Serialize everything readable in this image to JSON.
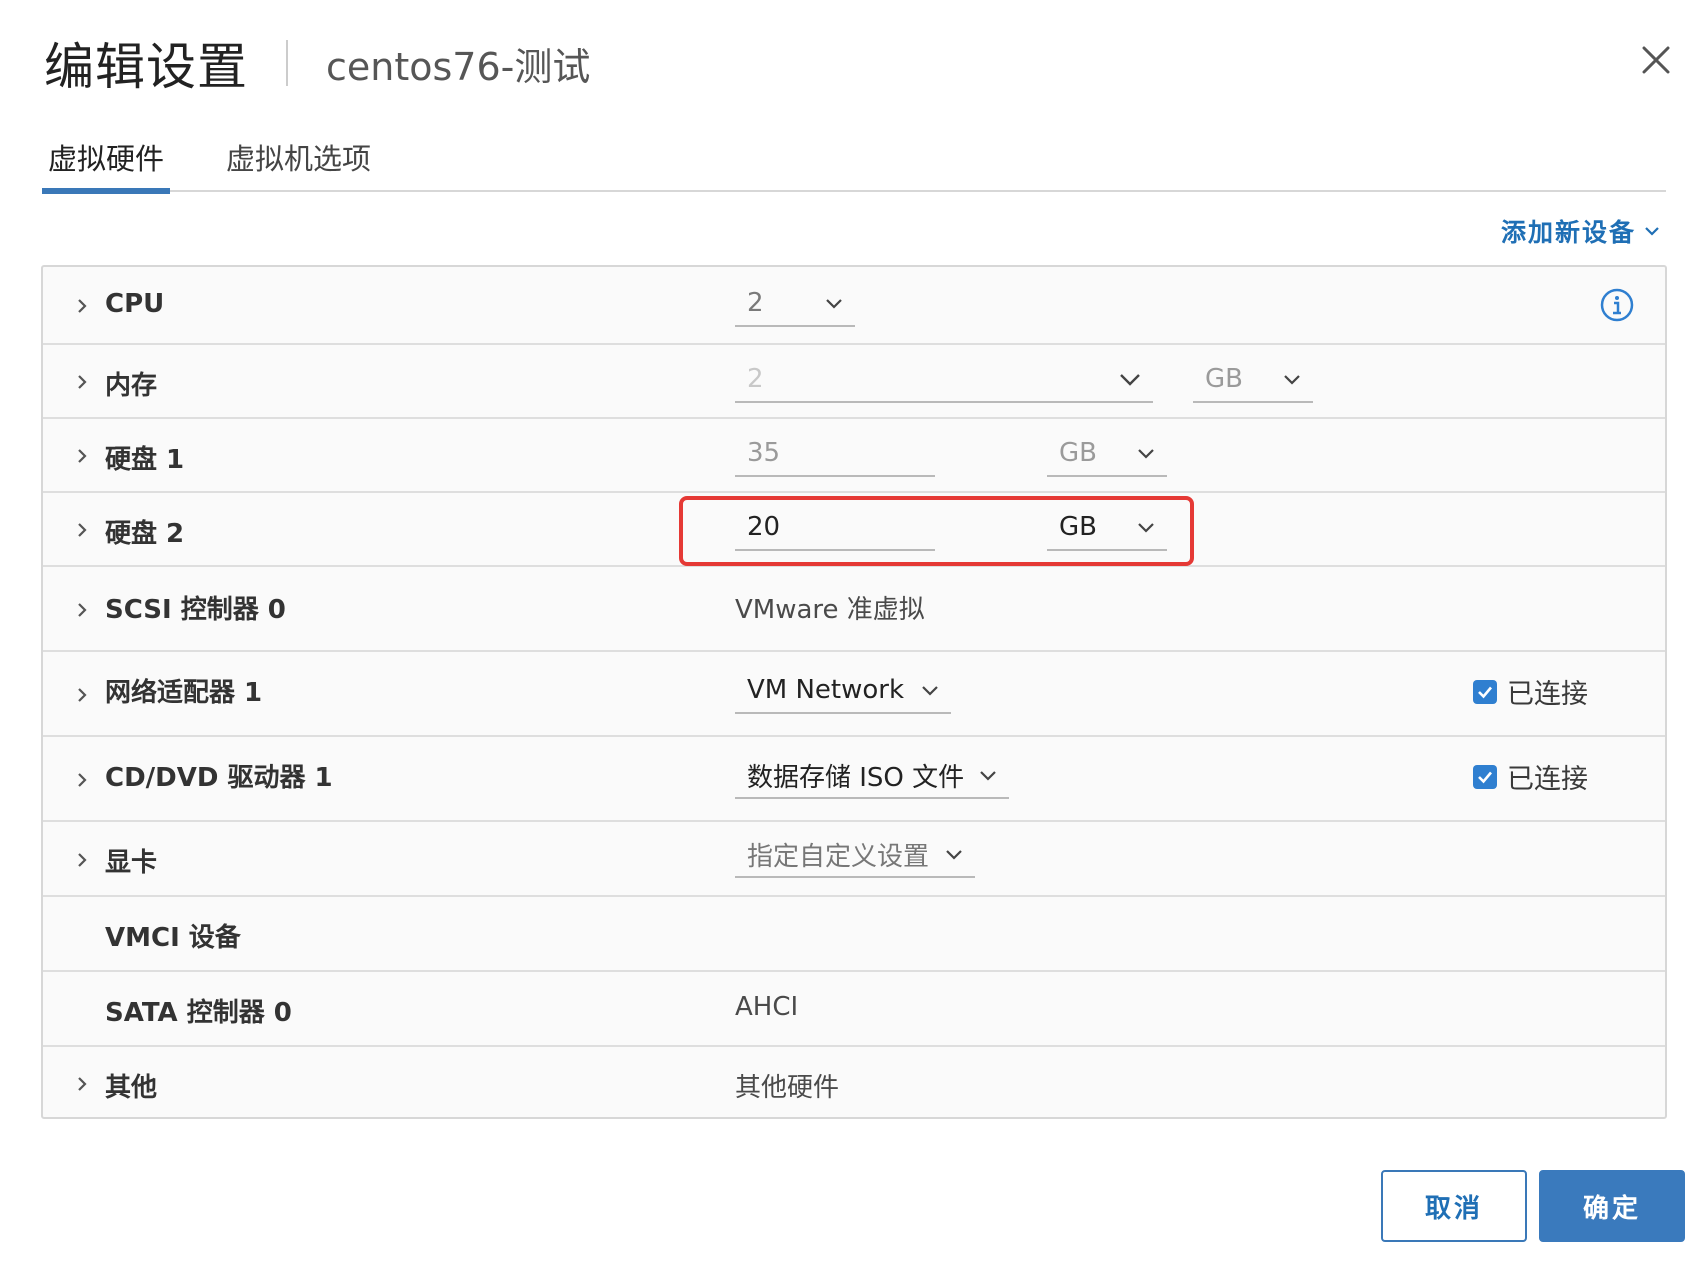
{
  "dialog": {
    "title": "编辑设置",
    "subtitle": "centos76-测试"
  },
  "tabs": [
    {
      "label": "虚拟硬件",
      "active": true
    },
    {
      "label": "虚拟机选项",
      "active": false
    }
  ],
  "add_device": "添加新设备",
  "rows": {
    "cpu": {
      "label": "CPU",
      "value": "2"
    },
    "memory": {
      "label": "内存",
      "value": "2",
      "unit": "GB"
    },
    "disk1": {
      "label": "硬盘 1",
      "value": "35",
      "unit": "GB"
    },
    "disk2": {
      "label": "硬盘 2",
      "value": "20",
      "unit": "GB"
    },
    "scsi": {
      "label": "SCSI 控制器 0",
      "value": "VMware 准虚拟"
    },
    "network": {
      "label": "网络适配器 1",
      "value": "VM Network",
      "connected_label": "已连接",
      "connected": true
    },
    "cddvd": {
      "label": "CD/DVD 驱动器 1",
      "value": "数据存储 ISO 文件",
      "connected_label": "已连接",
      "connected": true
    },
    "video": {
      "label": "显卡",
      "value": "指定自定义设置"
    },
    "vmci": {
      "label": "VMCI 设备"
    },
    "sata": {
      "label": "SATA 控制器 0",
      "value": "AHCI"
    },
    "other": {
      "label": "其他",
      "value": "其他硬件"
    }
  },
  "buttons": {
    "cancel": "取消",
    "ok": "确定"
  },
  "colors": {
    "accent": "#3a78b8",
    "link": "#1f6fb5",
    "highlight": "#e53935",
    "checkbox": "#2f7fd0"
  }
}
